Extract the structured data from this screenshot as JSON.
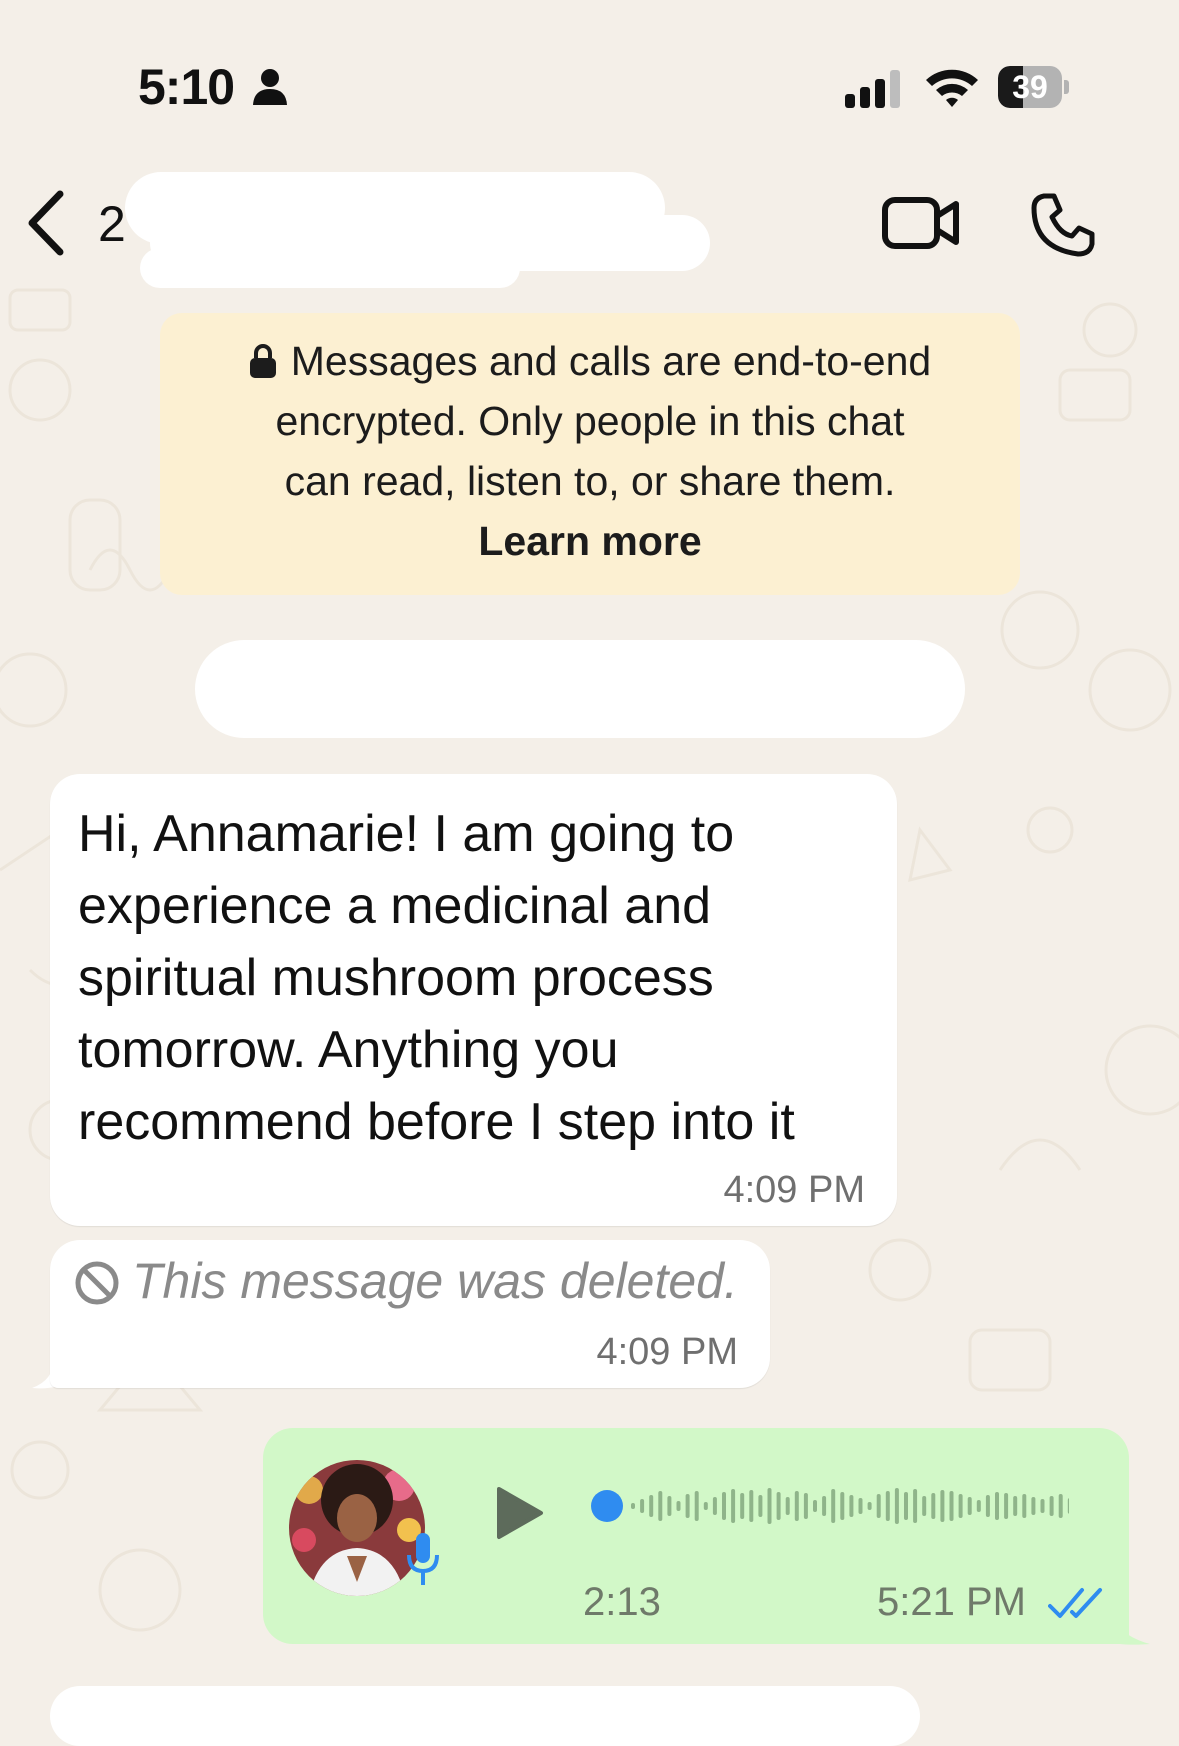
{
  "status_bar": {
    "time": "5:10",
    "battery_level": "39",
    "battery_fraction": 0.39
  },
  "header": {
    "back_label": "",
    "contact_name": "2",
    "icons": [
      "chevron-left-icon",
      "video-call-icon",
      "phone-call-icon"
    ]
  },
  "encryption_notice": {
    "lines": [
      "Messages and calls are end-to-end",
      "encrypted. Only people in this chat",
      "can read, listen to, or share them."
    ],
    "link_label": "Learn more"
  },
  "messages": [
    {
      "direction": "incoming",
      "lines": [
        "Hi, Annamarie! I am going to",
        "experience a medicinal and",
        "spiritual mushroom process",
        "tomorrow. Anything you",
        "recommend before I step into it"
      ],
      "time": "4:09 PM"
    },
    {
      "direction": "incoming",
      "deleted": true,
      "text": "This message was deleted.",
      "time": "4:09 PM"
    },
    {
      "direction": "outgoing",
      "type": "voice",
      "duration": "2:13",
      "time": "5:21 PM",
      "status": "read",
      "playback_progress": 0
    }
  ],
  "colors": {
    "chat_background": "#f4efe8",
    "incoming_bubble": "#ffffff",
    "outgoing_bubble": "#d2f8c8",
    "banner": "#fcf0d2",
    "read_ticks": "#2f8cf0",
    "waveform_dot": "#2f8cf0"
  }
}
